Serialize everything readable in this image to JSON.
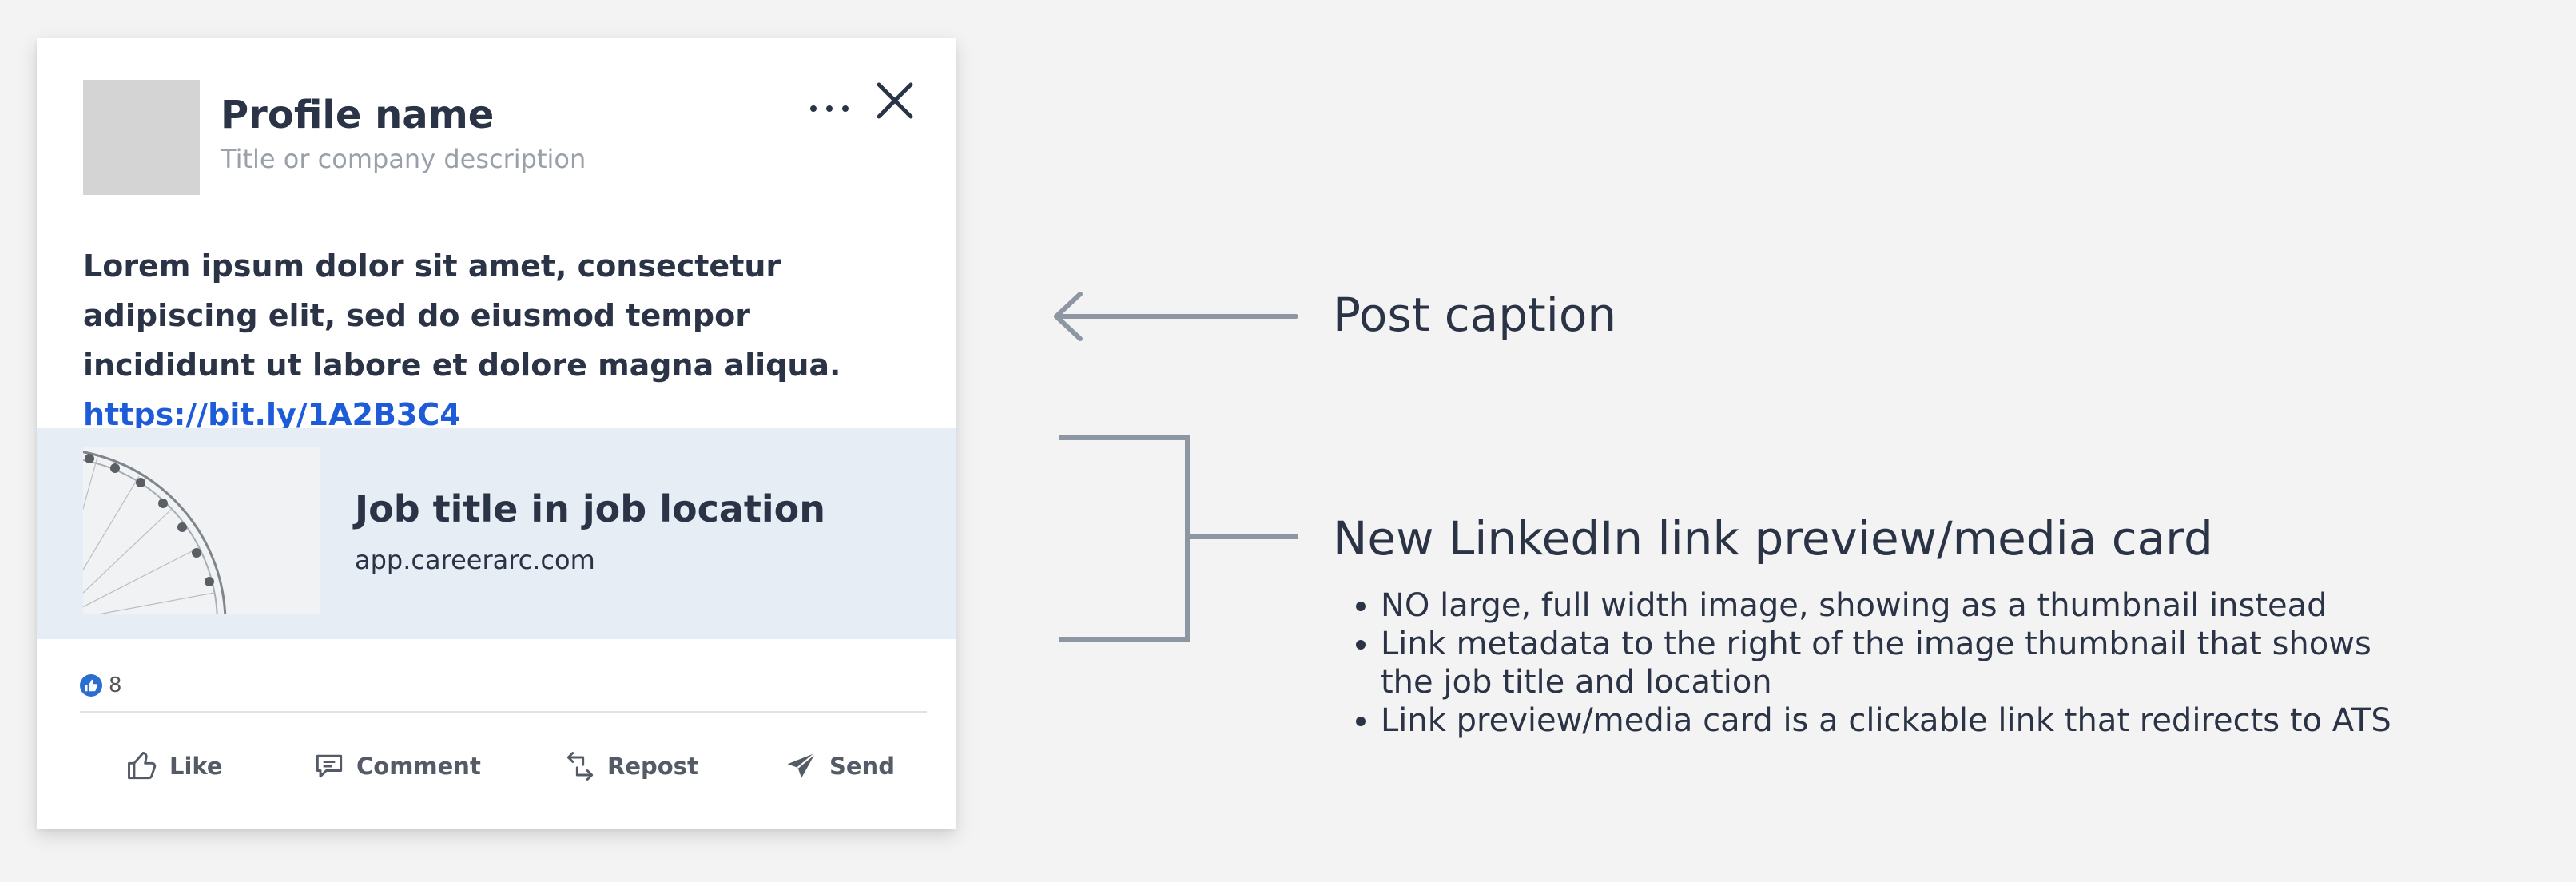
{
  "post": {
    "profile_name": "Profile name",
    "profile_description": "Title or company description",
    "caption_text": "Lorem ipsum dolor sit amet, consectetur adipiscing elit, sed do eiusmod tempor incididunt ut labore et dolore magna aliqua.",
    "caption_link": "https://bit.ly/1A2B3C4",
    "preview": {
      "title": "Job title in job location",
      "domain": "app.careerarc.com"
    },
    "reaction_count": "8",
    "actions": {
      "like": "Like",
      "comment": "Comment",
      "repost": "Repost",
      "send": "Send"
    }
  },
  "annotations": {
    "caption_label": "Post caption",
    "card_label": "New LinkedIn link preview/media card",
    "bullets": [
      "NO large, full width image, showing as a thumbnail instead",
      "Link metadata to the right of the image thumbnail that shows the job title and location",
      "Link preview/media card is a clickable link that redirects to ATS"
    ]
  },
  "colors": {
    "background": "#f3f3f3",
    "card": "#ffffff",
    "text": "#2b3446",
    "link": "#1e5bd8",
    "preview_bg": "#e6edf5",
    "annotation_line": "#8f96a3"
  }
}
